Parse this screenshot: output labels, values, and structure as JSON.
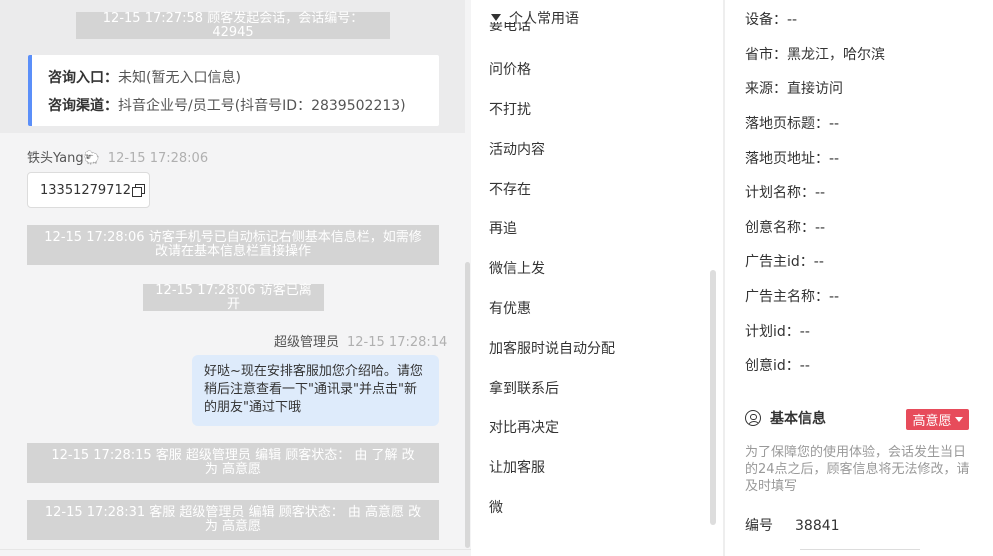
{
  "chat": {
    "session_start": "12-15 17:27:58 顾客发起会话，会话编号：42945",
    "entry_label": "咨询入口：",
    "entry_value": "未知(暂无入口信息)",
    "channel_label": "咨询渠道：",
    "channel_value": "抖音企业号/员工号(抖音号ID：2839502213)",
    "visitor_name": "铁头Yang🐑",
    "visitor_time": "12-15 17:28:06",
    "visitor_phone": "13351279712",
    "sys_phone_marked": "12-15 17:28:06 访客手机号已自动标记右侧基本信息栏，如需修改请在基本信息栏直接操作",
    "sys_visitor_left": "12-15 17:28:06 访客已离开",
    "agent_name": "超级管理员",
    "agent_time": "12-15 17:28:14",
    "agent_message": "好哒~现在安排客服加您介绍哈。请您稍后注意查看一下\"通讯录\"并点击\"新的朋友\"通过下哦",
    "sys_status_1": "12-15 17:28:15 客服 超级管理员 编辑 顾客状态： 由 了解 改为 高意愿",
    "sys_status_2": "12-15 17:28:31 客服 超级管理员 编辑 顾客状态： 由 高意愿 改为 高意愿"
  },
  "phrases": {
    "header": "个人常用语",
    "partial_top": "要电话",
    "items": [
      "问价格",
      "不打扰",
      "活动内容",
      "不存在",
      "再追",
      "微信上发",
      "有优惠",
      "加客服时说自动分配",
      "拿到联系后",
      "对比再决定",
      "让加客服",
      "微"
    ]
  },
  "info": {
    "fields": [
      "设备：--",
      "省市：黑龙江，哈尔滨",
      "来源：直接访问",
      "落地页标题：--",
      "落地页地址：--",
      "计划名称：--",
      "创意名称：--",
      "广告主id：--",
      "广告主名称：--",
      "计划id：--",
      "创意id：--"
    ],
    "basic_title": "基本信息",
    "intent_badge": "高意愿",
    "notice": "为了保障您的使用体验，会话发生当日的24点之后，顾客信息将无法修改，请及时填写",
    "id_label": "编号",
    "id_value": "38841"
  },
  "colors": {
    "accent_blue": "#5b8ff9",
    "agent_bubble": "#deebfb",
    "badge_red": "#e74c5b",
    "system_gray": "#d4d4d4"
  }
}
